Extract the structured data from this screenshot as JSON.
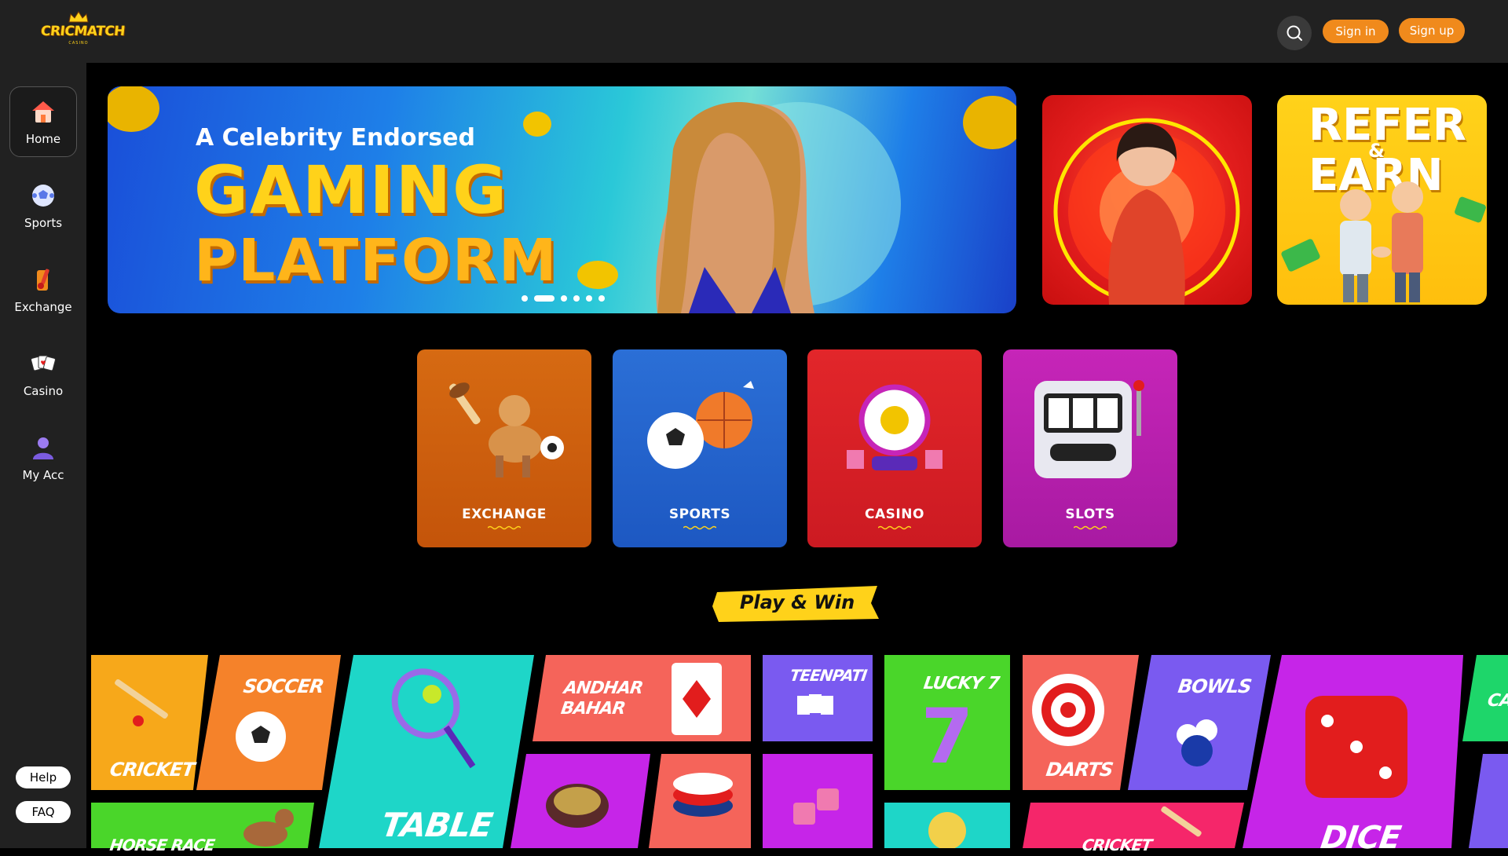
{
  "header": {
    "logo_text": "CRICMATCH",
    "logo_sub": "CASINO",
    "signin_label": "Sign in",
    "signup_label": "Sign up"
  },
  "sidebar": {
    "items": [
      {
        "label": "Home",
        "icon": "home-icon"
      },
      {
        "label": "Sports",
        "icon": "soccer-ball-icon"
      },
      {
        "label": "Exchange",
        "icon": "exchange-icon"
      },
      {
        "label": "Casino",
        "icon": "playing-cards-icon"
      },
      {
        "label": "My Acc",
        "icon": "user-icon"
      }
    ],
    "help_label": "Help",
    "faq_label": "FAQ"
  },
  "hero": {
    "tagline": "A Celebrity Endorsed",
    "line1": "GAMING",
    "line2": "PLATFORM",
    "slide_count": 6,
    "active_slide": 2
  },
  "promos": {
    "refer_line1": "REFER",
    "refer_amp": "&",
    "refer_line2": "EARN"
  },
  "categories": [
    {
      "label": "EXCHANGE"
    },
    {
      "label": "SPORTS"
    },
    {
      "label": "CASINO"
    },
    {
      "label": "SLOTS"
    }
  ],
  "play_win": "Play & Win",
  "games": {
    "cricket": "CRICKET",
    "soccer": "SOCCER",
    "table": "TABLE",
    "andhar": "ANDHAR",
    "bahar": "BAHAR",
    "teenpati": "TEENPATI",
    "lucky7": "LUCKY 7",
    "darts": "DARTS",
    "bowls": "BOWLS",
    "dice": "DICE",
    "horse_race": "HORSE RACE",
    "cricket2": "CRICKET",
    "cards": "CA"
  },
  "colors": {
    "accent": "#f08a1c",
    "bar": "#212121",
    "brand_yellow": "#ffd21a"
  }
}
